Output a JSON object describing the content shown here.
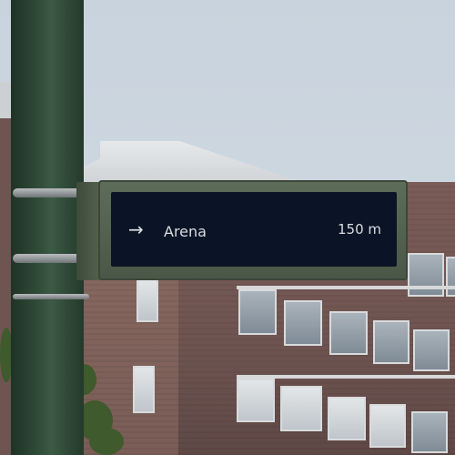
{
  "sign": {
    "arrow": "→",
    "destination": "Arena",
    "distance": "150 m"
  }
}
